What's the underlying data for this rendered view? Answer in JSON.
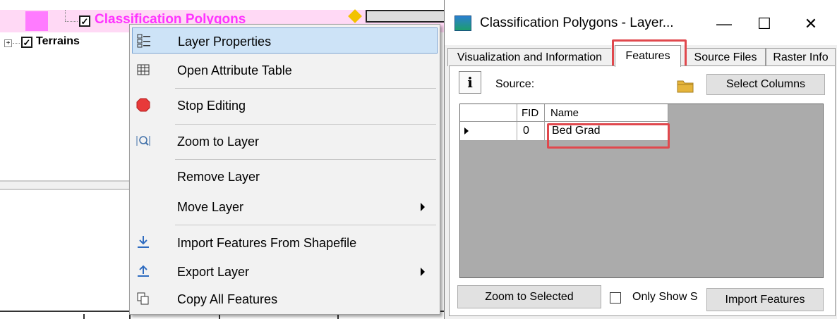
{
  "tree": {
    "layer1_name": "Classification Polygons",
    "layer2_name": "Terrains",
    "check_glyph": "✓",
    "expand_glyph": "+"
  },
  "context_menu": {
    "items": [
      {
        "label": "Layer Properties",
        "icon": "layer-properties-icon"
      },
      {
        "label": "Open Attribute Table",
        "icon": "table-icon"
      },
      {
        "label": "Stop Editing",
        "icon": "stop-icon"
      },
      {
        "label": "Zoom to Layer",
        "icon": "zoom-icon"
      },
      {
        "label": "Remove Layer",
        "icon": ""
      },
      {
        "label": "Move Layer",
        "icon": ""
      },
      {
        "label": "Import Features From Shapefile",
        "icon": "import-icon"
      },
      {
        "label": "Export Layer",
        "icon": "export-icon"
      },
      {
        "label": "Copy All Features",
        "icon": "copy-icon"
      }
    ]
  },
  "dialog": {
    "title": "Classification Polygons - Layer...",
    "controls": {
      "minimize": "—",
      "maximize": "☐",
      "close": "✕"
    },
    "tabs": [
      {
        "label": "Visualization and Information"
      },
      {
        "label": "Features"
      },
      {
        "label": "Source Files"
      },
      {
        "label": "Raster Info"
      }
    ],
    "info_button": "i",
    "source_label": "Source:",
    "select_columns_label": "Select Columns",
    "table": {
      "columns": [
        "FID",
        "Name"
      ],
      "rows": [
        {
          "fid": "0",
          "name": "Bed Grad"
        }
      ]
    },
    "zoom_selected_label": "Zoom to Selected",
    "only_show_label": "Only Show S",
    "import_features_label": "Import Features"
  },
  "colors": {
    "highlight_red": "#e0484d",
    "menu_hover": "#cde3f7",
    "layer_pink": "#ff33ff",
    "grid_bg": "#ababab"
  }
}
